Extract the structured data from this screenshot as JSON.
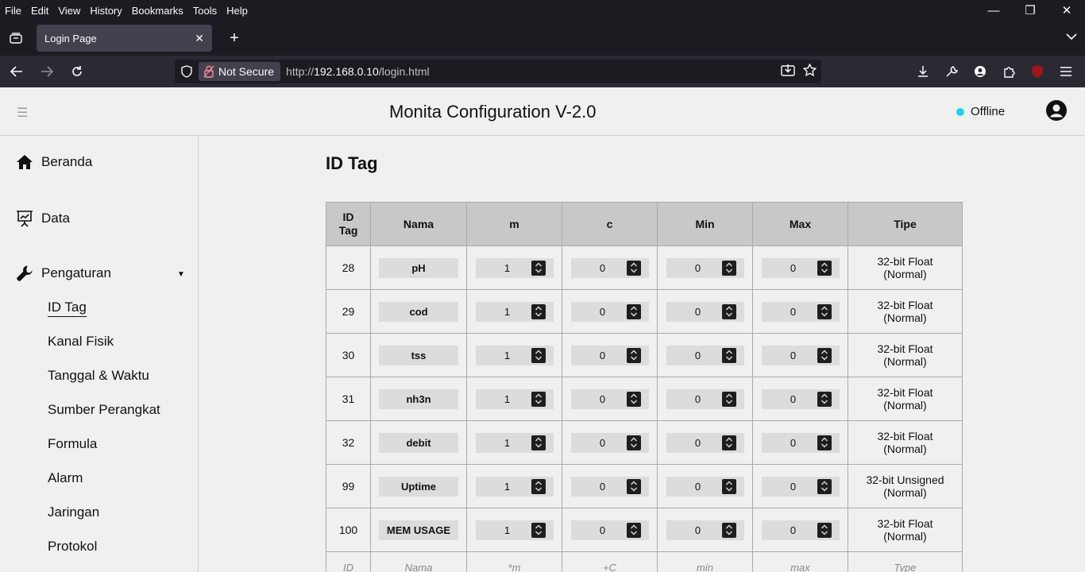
{
  "browser": {
    "menu": [
      "File",
      "Edit",
      "View",
      "History",
      "Bookmarks",
      "Tools",
      "Help"
    ],
    "tab_title": "Login Page",
    "security_label": "Not Secure",
    "url_prefix": "http://",
    "url_host": "192.168.0.10",
    "url_path": "/login.html"
  },
  "header": {
    "title": "Monita Configuration V-2.0",
    "status": "Offline",
    "status_color": "#20d0e8"
  },
  "sidebar": {
    "main": [
      {
        "label": "Beranda",
        "icon": "home-icon"
      },
      {
        "label": "Data",
        "icon": "presentation-chart-icon"
      },
      {
        "label": "Pengaturan",
        "icon": "wrench-icon"
      }
    ],
    "sub": [
      "ID Tag",
      "Kanal Fisik",
      "Tanggal & Waktu",
      "Sumber Perangkat",
      "Formula",
      "Alarm",
      "Jaringan",
      "Protokol"
    ],
    "active": "ID Tag"
  },
  "main": {
    "title": "ID Tag",
    "columns": [
      "ID Tag",
      "Nama",
      "m",
      "c",
      "Min",
      "Max",
      "Tipe"
    ],
    "rows": [
      {
        "id": "28",
        "nama": "pH",
        "m": "1",
        "c": "0",
        "min": "0",
        "max": "0",
        "tipe1": "32-bit Float",
        "tipe2": "(Normal)"
      },
      {
        "id": "29",
        "nama": "cod",
        "m": "1",
        "c": "0",
        "min": "0",
        "max": "0",
        "tipe1": "32-bit Float",
        "tipe2": "(Normal)"
      },
      {
        "id": "30",
        "nama": "tss",
        "m": "1",
        "c": "0",
        "min": "0",
        "max": "0",
        "tipe1": "32-bit Float",
        "tipe2": "(Normal)"
      },
      {
        "id": "31",
        "nama": "nh3n",
        "m": "1",
        "c": "0",
        "min": "0",
        "max": "0",
        "tipe1": "32-bit Float",
        "tipe2": "(Normal)"
      },
      {
        "id": "32",
        "nama": "debit",
        "m": "1",
        "c": "0",
        "min": "0",
        "max": "0",
        "tipe1": "32-bit Float",
        "tipe2": "(Normal)"
      },
      {
        "id": "99",
        "nama": "Uptime",
        "m": "1",
        "c": "0",
        "min": "0",
        "max": "0",
        "tipe1": "32-bit Unsigned",
        "tipe2": "(Normal)"
      },
      {
        "id": "100",
        "nama": "MEM USAGE",
        "m": "1",
        "c": "0",
        "min": "0",
        "max": "0",
        "tipe1": "32-bit Float",
        "tipe2": "(Normal)"
      }
    ],
    "placeholder_row": [
      "ID",
      "Nama",
      "*m",
      "+C",
      "min",
      "max",
      "Type"
    ]
  }
}
